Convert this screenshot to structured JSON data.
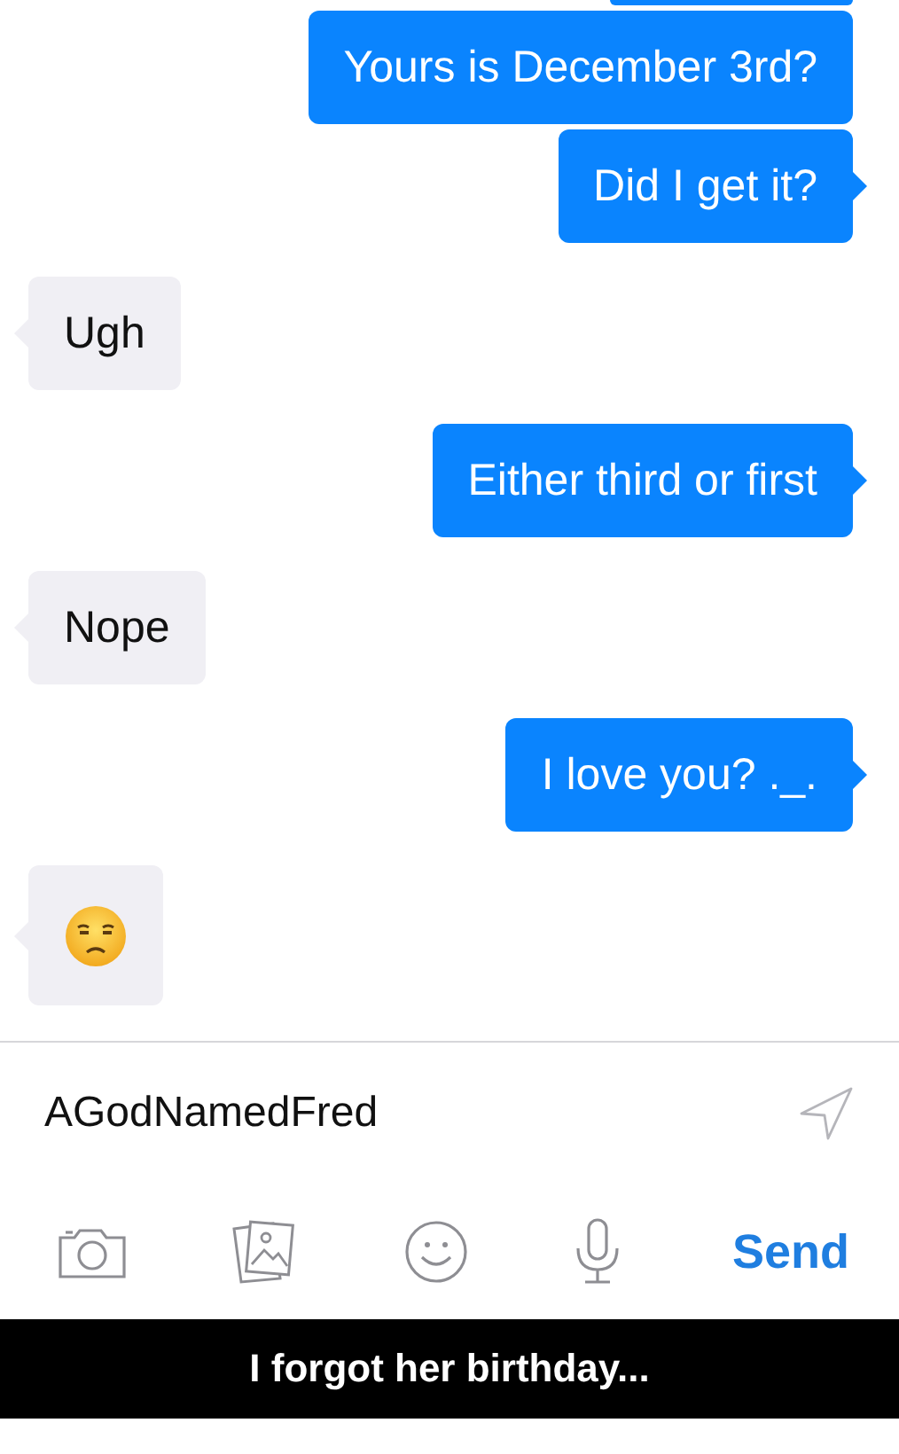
{
  "messages": [
    {
      "outgoing": true,
      "kind": "clipped"
    },
    {
      "outgoing": true,
      "kind": "text",
      "text": "Yours is December 3rd?"
    },
    {
      "outgoing": true,
      "kind": "text",
      "text": "Did I get it?"
    },
    {
      "outgoing": false,
      "kind": "text",
      "text": "Ugh"
    },
    {
      "outgoing": true,
      "kind": "text",
      "text": "Either third or first"
    },
    {
      "outgoing": false,
      "kind": "text",
      "text": "Nope"
    },
    {
      "outgoing": true,
      "kind": "text",
      "text": "I love you? ._."
    },
    {
      "outgoing": false,
      "kind": "emoji"
    }
  ],
  "composer": {
    "value": "AGodNamedFred",
    "send_button": "Send"
  },
  "caption": "I forgot her birthday..."
}
